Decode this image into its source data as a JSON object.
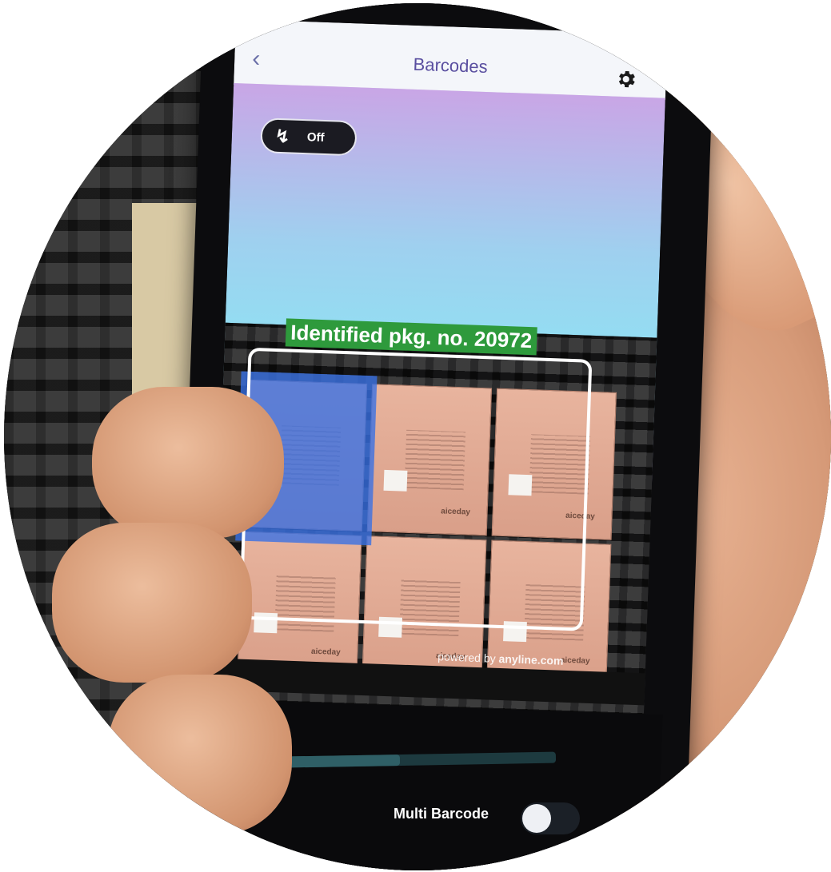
{
  "app": {
    "title": "Barcodes"
  },
  "flash": {
    "label": "Off",
    "state": "off"
  },
  "scan": {
    "result_label": "Identified pkg. no. 20972",
    "powered_prefix": "powered by",
    "powered_brand": "anyline.com",
    "box_brand": "aiceday"
  },
  "controls": {
    "multi_barcode_label": "Multi Barcode",
    "multi_barcode_enabled": false,
    "progress_fraction": 0.5
  },
  "colors": {
    "accent": "#5a4fa0",
    "highlight": "#3670e6",
    "result_badge": "#2e9a3c"
  }
}
